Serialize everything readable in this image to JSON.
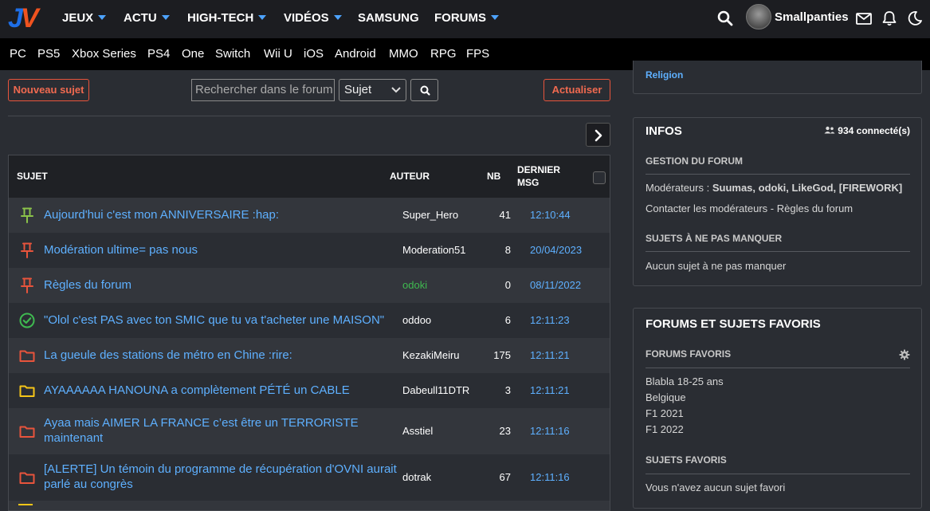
{
  "brand": {
    "logo_j": "J",
    "logo_v": "V"
  },
  "nav": {
    "items": [
      {
        "label": "JEUX",
        "dropdown": true
      },
      {
        "label": "ACTU",
        "dropdown": true
      },
      {
        "label": "HIGH-TECH",
        "dropdown": true
      },
      {
        "label": "VIDÉOS",
        "dropdown": true
      },
      {
        "label": "SAMSUNG",
        "dropdown": false
      },
      {
        "label": "FORUMS",
        "dropdown": true
      }
    ],
    "username": "Smallpanties",
    "icons": [
      "search-icon",
      "mail-icon",
      "bell-icon",
      "moon-icon"
    ]
  },
  "platforms": [
    "PC",
    "PS5",
    "Xbox Series",
    "PS4",
    "One",
    "Switch",
    "Wii U",
    "iOS",
    "Android",
    "MMO",
    "RPG",
    "FPS"
  ],
  "toolbar": {
    "new_topic": "Nouveau sujet",
    "search_placeholder": "Rechercher dans le forum",
    "search_scope": "Sujet",
    "refresh": "Actualiser"
  },
  "table": {
    "headers": {
      "subject": "SUJET",
      "author": "AUTEUR",
      "count": "NB",
      "last1": "DERNIER",
      "last2": "MSG"
    },
    "rows": [
      {
        "icon": "pin-green-icon",
        "title": "Aujourd'hui c'est mon ANNIVERSAIRE :hap:",
        "author": "Super_Hero",
        "nb": "41",
        "last": "12:10:44"
      },
      {
        "icon": "pin-red-icon",
        "title": "Modération ultime= pas nous",
        "author": "Moderation51",
        "nb": "8",
        "last": "20/04/2023"
      },
      {
        "icon": "pin-red-icon",
        "title": "Règles du forum",
        "author": "odoki",
        "nb": "0",
        "last": "08/11/2022"
      },
      {
        "icon": "check-circle-icon",
        "title": "\"Olol c'est PAS avec ton SMIC que tu va t'acheter une MAISON\"",
        "author": "oddoo",
        "nb": "6",
        "last": "12:11:23"
      },
      {
        "icon": "folder-red-icon",
        "title": "La gueule des stations de métro en Chine :rire:",
        "author": "KezakiMeiru",
        "nb": "175",
        "last": "12:11:21"
      },
      {
        "icon": "folder-yellow-icon",
        "title": "AYAAAAAA HANOUNA a complètement PÉTÉ un CABLE",
        "author": "Dabeull11DTR",
        "nb": "3",
        "last": "12:11:21"
      },
      {
        "icon": "folder-red-icon",
        "title": "Ayaa mais AIMER LA FRANCE c’est être un TERRORISTE maintenant",
        "author": "Asstiel",
        "nb": "23",
        "last": "12:11:16"
      },
      {
        "icon": "folder-red-icon",
        "title": "[ALERTE] Un témoin du programme de récupération d'OVNI aurait parlé au congrès",
        "author": "dotrak",
        "nb": "67",
        "last": "12:11:16"
      }
    ]
  },
  "sidebar": {
    "top_link": "Religion",
    "infos": {
      "title": "INFOS",
      "online": "934 connecté(s)",
      "gestion_title": "GESTION DU FORUM",
      "moderators_label": "Modérateurs : ",
      "moderators": "Suumas, odoki, LikeGod, [FIREWORK]",
      "contact": "Contacter les modérateurs",
      "separator": " - ",
      "rules": "Règles du forum",
      "not_miss_title": "SUJETS À NE PAS MANQUER",
      "not_miss_text": "Aucun sujet à ne pas manquer"
    },
    "favs": {
      "title": "FORUMS ET SUJETS FAVORIS",
      "forums_title": "FORUMS FAVORIS",
      "forums": [
        "Blabla 18-25 ans",
        "Belgique",
        "F1 2021",
        "F1 2022"
      ],
      "topics_title": "SUJETS FAVORIS",
      "topics_text": "Vous n'avez aucun sujet favori"
    }
  }
}
